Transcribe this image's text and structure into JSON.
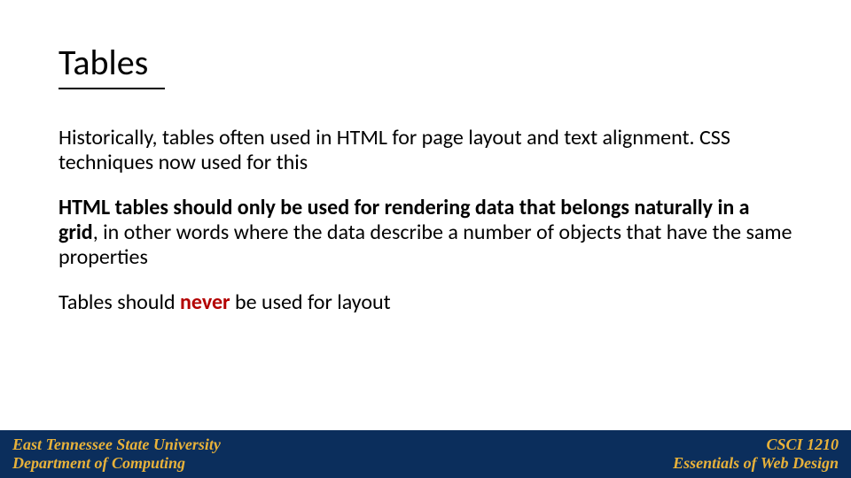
{
  "slide": {
    "title": "Tables",
    "para1": "Historically, tables often used in HTML for page layout and text alignment.  CSS techniques now used for this",
    "para2_bold": "HTML tables should only be used for rendering data that belongs naturally in a grid",
    "para2_rest": ", in other words where the data describe a number of objects that have the same properties",
    "para3_pre": "Tables should ",
    "para3_never": "never",
    "para3_post": " be used for layout"
  },
  "footer": {
    "left_line1": "East Tennessee State University",
    "left_line2": "Department of Computing",
    "right_line1": "CSCI 1210",
    "right_line2": "Essentials of Web Design"
  }
}
